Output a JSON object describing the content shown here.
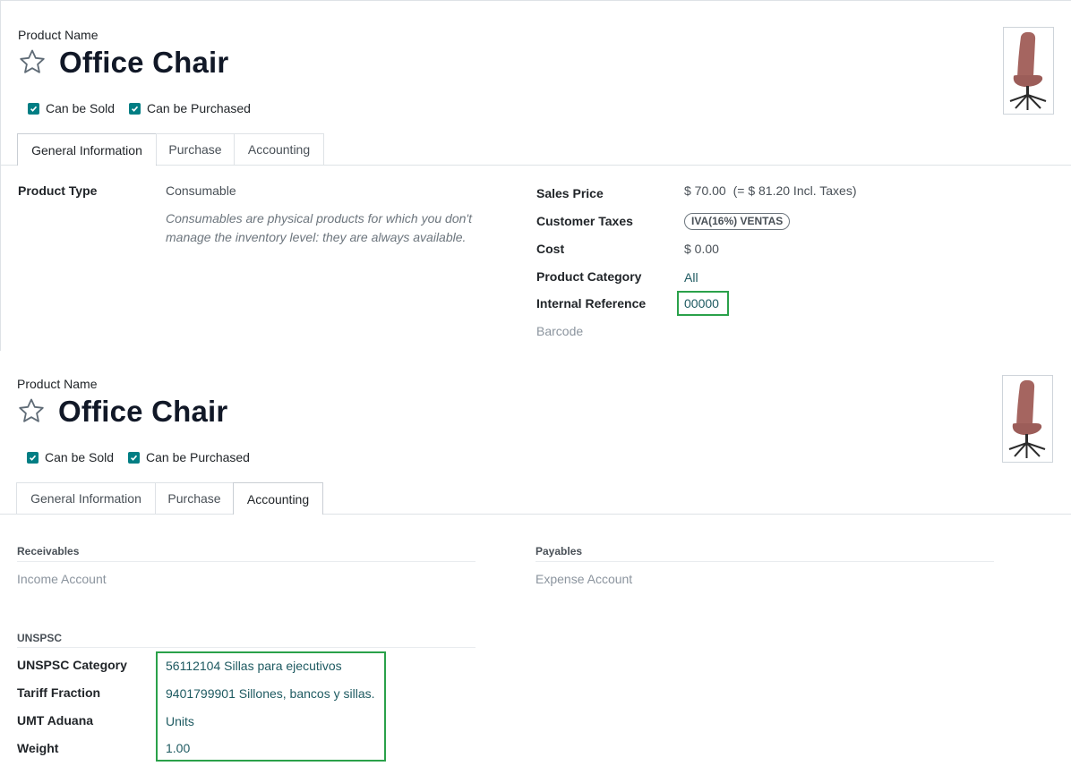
{
  "top": {
    "product_name_label": "Product Name",
    "title": "Office Chair",
    "can_be_sold": "Can be Sold",
    "can_be_purchased": "Can be Purchased",
    "tabs": [
      "General Information",
      "Purchase",
      "Accounting"
    ],
    "active_tab": "General Information",
    "product_type_label": "Product Type",
    "product_type_value": "Consumable",
    "product_type_help": "Consumables are physical products for which you don't manage the inventory level: they are always available.",
    "sales_price_label": "Sales Price",
    "sales_price_value": "$ 70.00",
    "sales_price_incl": "(= $ 81.20 Incl. Taxes)",
    "customer_taxes_label": "Customer Taxes",
    "customer_taxes_badge": "IVA(16%) VENTAS",
    "cost_label": "Cost",
    "cost_value": "$ 0.00",
    "product_category_label": "Product Category",
    "product_category_value": "All",
    "internal_reference_label": "Internal Reference",
    "internal_reference_value": "00000",
    "barcode_label": "Barcode"
  },
  "bottom": {
    "product_name_label": "Product Name",
    "title": "Office Chair",
    "can_be_sold": "Can be Sold",
    "can_be_purchased": "Can be Purchased",
    "tabs": [
      "General Information",
      "Purchase",
      "Accounting"
    ],
    "active_tab": "Accounting",
    "receivables_title": "Receivables",
    "income_account_label": "Income Account",
    "payables_title": "Payables",
    "expense_account_label": "Expense Account",
    "unspsc_title": "UNSPSC",
    "unspsc_category_label": "UNSPSC Category",
    "unspsc_category_value": "56112104 Sillas para ejecutivos",
    "tariff_fraction_label": "Tariff Fraction",
    "tariff_fraction_value": "9401799901 Sillones, bancos y sillas.",
    "umt_aduana_label": "UMT Aduana",
    "umt_aduana_value": "Units",
    "weight_label": "Weight",
    "weight_value": "1.00"
  },
  "icons": {
    "favorite": "star-outline-icon",
    "checkbox": "checkbox-checked-icon",
    "product_image": "office-chair-image"
  },
  "colors": {
    "checkbox": "#017e84",
    "link": "#1e5a61",
    "highlight": "#2aa14a"
  }
}
